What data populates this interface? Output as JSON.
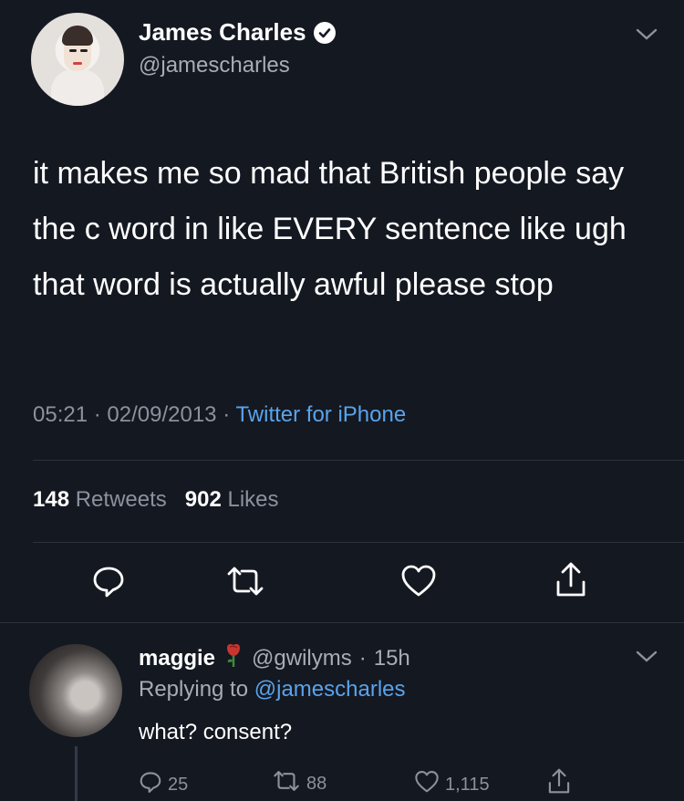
{
  "tweet": {
    "author_name": "James Charles",
    "author_handle": "@jamescharles",
    "text": "it makes me so mad that British people say the c word in like EVERY sentence like ugh that word is actually awful please stop",
    "time": "05:21",
    "date": "02/09/2013",
    "client": "Twitter for iPhone",
    "retweets_count": "148",
    "retweets_label": "Retweets",
    "likes_count": "902",
    "likes_label": "Likes",
    "separator": "·"
  },
  "reply": {
    "author_name": "maggie",
    "author_handle": "@gwilyms",
    "age": "15h",
    "replying_prefix": "Replying to",
    "replying_to": "@jamescharles",
    "text": "what? consent?",
    "reply_count": "25",
    "retweet_count": "88",
    "like_count": "1,115"
  },
  "icons": {
    "verified": "verified-badge-icon",
    "menu": "chevron-down-icon",
    "reply": "reply-icon",
    "retweet": "retweet-icon",
    "like": "heart-icon",
    "share": "share-icon",
    "rose": "rose-emoji"
  },
  "colors": {
    "background": "#141821",
    "link": "#5aa3ea",
    "muted": "#8b929c"
  }
}
